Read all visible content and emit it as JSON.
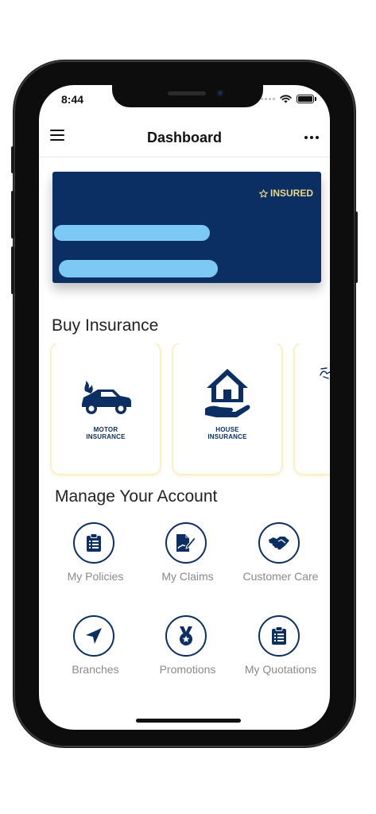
{
  "status_bar": {
    "time": "8:44"
  },
  "app_bar": {
    "title": "Dashboard"
  },
  "policy_card": {
    "badge": "INSURED",
    "badge_icon": "star-outline-icon",
    "background": "#0b2f63"
  },
  "buy_insurance": {
    "title": "Buy Insurance",
    "items": [
      {
        "label_line1": "MOTOR",
        "label_line2": "INSURANCE",
        "icon": "car-fire-icon"
      },
      {
        "label_line1": "HOUSE",
        "label_line2": "INSURANCE",
        "icon": "house-hand-icon"
      }
    ]
  },
  "manage_account": {
    "title": "Manage Your Account",
    "items": [
      {
        "label": "My Policies",
        "icon": "clipboard-list-icon"
      },
      {
        "label": "My Claims",
        "icon": "file-signature-icon"
      },
      {
        "label": "Customer Care",
        "icon": "handshake-icon"
      },
      {
        "label": "Branches",
        "icon": "location-arrow-icon"
      },
      {
        "label": "Promotions",
        "icon": "medal-icon"
      },
      {
        "label": "My Quotations",
        "icon": "clipboard-list-icon"
      }
    ]
  },
  "colors": {
    "primary": "#0b2f63",
    "accent": "#e8d88a",
    "muted_text": "#8a8a8a"
  }
}
